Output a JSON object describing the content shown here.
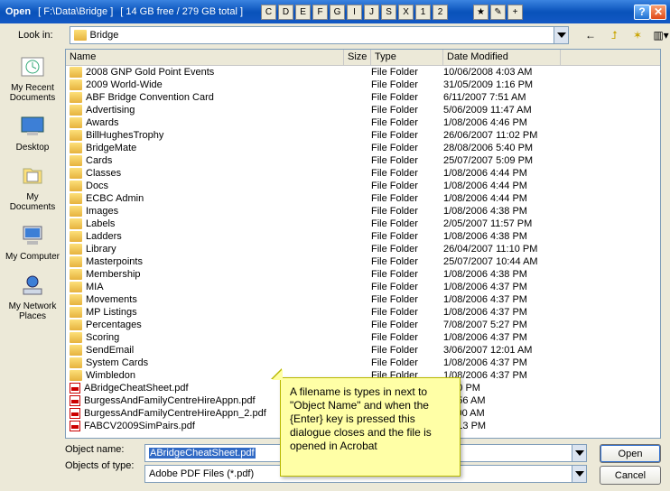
{
  "titlebar": {
    "label": "Open",
    "path": "[ F:\\Data\\Bridge ]",
    "freespace": "[ 14 GB free / 279 GB total ]",
    "drive_buttons": [
      "C",
      "D",
      "E",
      "F",
      "G",
      "I",
      "J",
      "S",
      "X",
      "1",
      "2"
    ],
    "hist_buttons": [
      "★",
      "✎",
      "+"
    ]
  },
  "lookin": {
    "label": "Look in:",
    "value": "Bridge"
  },
  "headers": {
    "name": "Name",
    "size": "Size",
    "type": "Type",
    "date": "Date Modified"
  },
  "places": [
    {
      "label": "My Recent Documents",
      "icon": "recent"
    },
    {
      "label": "Desktop",
      "icon": "desktop"
    },
    {
      "label": "My Documents",
      "icon": "mydocs"
    },
    {
      "label": "My Computer",
      "icon": "mycomputer"
    },
    {
      "label": "My Network Places",
      "icon": "network"
    }
  ],
  "files": [
    {
      "name": "2008 GNP Gold Point Events",
      "type": "File Folder",
      "date": "10/06/2008 4:03 AM",
      "kind": "folder"
    },
    {
      "name": "2009 World-Wide",
      "type": "File Folder",
      "date": "31/05/2009 1:16 PM",
      "kind": "folder"
    },
    {
      "name": "ABF Bridge Convention Card",
      "type": "File Folder",
      "date": "6/11/2007 7:51 AM",
      "kind": "folder"
    },
    {
      "name": "Advertising",
      "type": "File Folder",
      "date": "5/06/2009 11:47 AM",
      "kind": "folder"
    },
    {
      "name": "Awards",
      "type": "File Folder",
      "date": "1/08/2006 4:46 PM",
      "kind": "folder"
    },
    {
      "name": "BillHughesTrophy",
      "type": "File Folder",
      "date": "26/06/2007 11:02 PM",
      "kind": "folder"
    },
    {
      "name": "BridgeMate",
      "type": "File Folder",
      "date": "28/08/2006 5:40 PM",
      "kind": "folder"
    },
    {
      "name": "Cards",
      "type": "File Folder",
      "date": "25/07/2007 5:09 PM",
      "kind": "folder"
    },
    {
      "name": "Classes",
      "type": "File Folder",
      "date": "1/08/2006 4:44 PM",
      "kind": "folder"
    },
    {
      "name": "Docs",
      "type": "File Folder",
      "date": "1/08/2006 4:44 PM",
      "kind": "folder"
    },
    {
      "name": "ECBC Admin",
      "type": "File Folder",
      "date": "1/08/2006 4:44 PM",
      "kind": "folder"
    },
    {
      "name": "Images",
      "type": "File Folder",
      "date": "1/08/2006 4:38 PM",
      "kind": "folder"
    },
    {
      "name": "Labels",
      "type": "File Folder",
      "date": "2/05/2007 11:57 PM",
      "kind": "folder"
    },
    {
      "name": "Ladders",
      "type": "File Folder",
      "date": "1/08/2006 4:38 PM",
      "kind": "folder"
    },
    {
      "name": "Library",
      "type": "File Folder",
      "date": "26/04/2007 11:10 PM",
      "kind": "folder"
    },
    {
      "name": "Masterpoints",
      "type": "File Folder",
      "date": "25/07/2007 10:44 AM",
      "kind": "folder"
    },
    {
      "name": "Membership",
      "type": "File Folder",
      "date": "1/08/2006 4:38 PM",
      "kind": "folder"
    },
    {
      "name": "MIA",
      "type": "File Folder",
      "date": "1/08/2006 4:37 PM",
      "kind": "folder"
    },
    {
      "name": "Movements",
      "type": "File Folder",
      "date": "1/08/2006 4:37 PM",
      "kind": "folder"
    },
    {
      "name": "MP Listings",
      "type": "File Folder",
      "date": "1/08/2006 4:37 PM",
      "kind": "folder"
    },
    {
      "name": "Percentages",
      "type": "File Folder",
      "date": "7/08/2007 5:27 PM",
      "kind": "folder"
    },
    {
      "name": "Scoring",
      "type": "File Folder",
      "date": "1/08/2006 4:37 PM",
      "kind": "folder"
    },
    {
      "name": "SendEmail",
      "type": "File Folder",
      "date": "3/06/2007 12:01 AM",
      "kind": "folder"
    },
    {
      "name": "System Cards",
      "type": "File Folder",
      "date": "1/08/2006 4:37 PM",
      "kind": "folder"
    },
    {
      "name": "Wimbledon",
      "type": "File Folder",
      "date": "1/08/2006 4:37 PM",
      "kind": "folder"
    },
    {
      "name": "ABridgeCheatSheet.pdf",
      "type": "",
      "date": "8:30 PM",
      "kind": "pdf"
    },
    {
      "name": "BurgessAndFamilyCentreHireAppn.pdf",
      "type": "",
      "date": "10:56 AM",
      "kind": "pdf"
    },
    {
      "name": "BurgessAndFamilyCentreHireAppn_2.pdf",
      "type": "",
      "date": "11:00 AM",
      "kind": "pdf"
    },
    {
      "name": "FABCV2009SimPairs.pdf",
      "type": "",
      "date": "10:13 PM",
      "kind": "pdf"
    }
  ],
  "bottom": {
    "object_name_label": "Object name:",
    "object_name_value": "ABridgeCheatSheet.pdf",
    "type_label": "Objects of type:",
    "type_value": "Adobe PDF Files (*.pdf)",
    "open": "Open",
    "cancel": "Cancel"
  },
  "callout_text": "A filename is types in next to \"Object Name\" and when the {Enter} key is pressed this dialogue closes and the file is opened in Acrobat"
}
